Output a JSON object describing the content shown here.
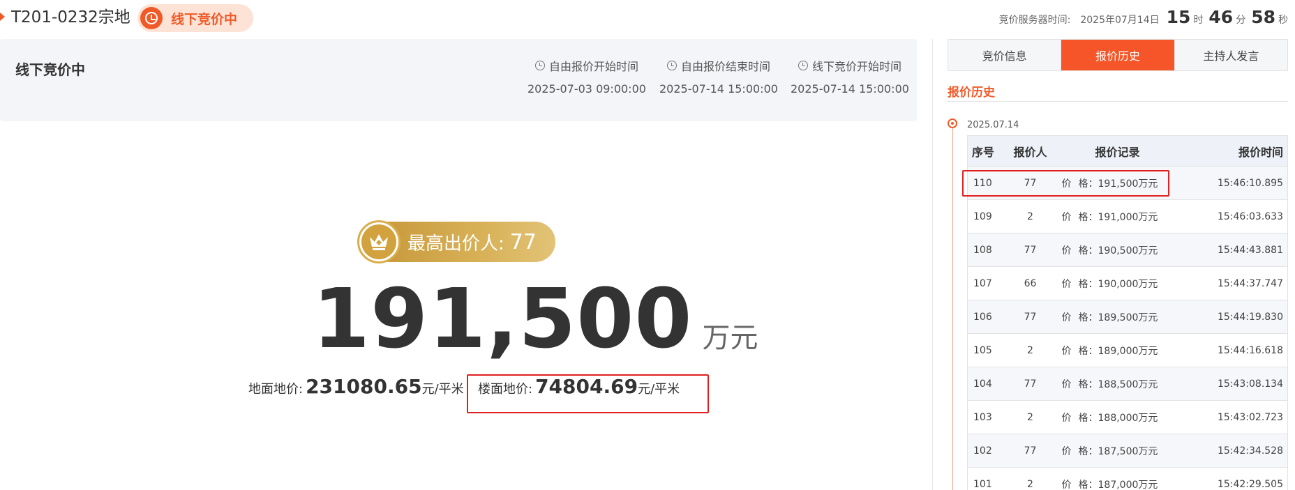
{
  "header": {
    "lot_code": "T201-0232宗地",
    "status": "线下竞价中",
    "server_time_label": "竞价服务器时间:",
    "server_date": "2025年07月14日",
    "hour": "15",
    "hour_unit": "时",
    "minute": "46",
    "minute_unit": "分",
    "second": "58",
    "second_unit": "秒"
  },
  "info": {
    "title": "线下竞价中",
    "times": [
      {
        "label": "自由报价开始时间",
        "value": "2025-07-03 09:00:00"
      },
      {
        "label": "自由报价结束时间",
        "value": "2025-07-14 15:00:00"
      },
      {
        "label": "线下竞价开始时间",
        "value": "2025-07-14 15:00:00"
      }
    ]
  },
  "price": {
    "top_bidder_label": "最高出价人:",
    "top_bidder": "77",
    "amount": "191,500",
    "amount_unit": "万元",
    "land_label": "地面地价:",
    "land_value": "231080.65",
    "land_unit": "元/平米",
    "floor_label": "楼面地价:",
    "floor_value": "74804.69",
    "floor_unit": "元/平米"
  },
  "tabs": [
    {
      "label": "竞价信息",
      "active": false
    },
    {
      "label": "报价历史",
      "active": true
    },
    {
      "label": "主持人发言",
      "active": false
    }
  ],
  "history": {
    "title": "报价历史",
    "date": "2025.07.14",
    "columns": [
      "序号",
      "报价人",
      "报价记录",
      "报价时间"
    ],
    "rows": [
      {
        "seq": "110",
        "bidder": "77",
        "rec_a": "价",
        "rec_b": "格：191,500万元",
        "time": "15:46:10.895"
      },
      {
        "seq": "109",
        "bidder": "2",
        "rec_a": "价",
        "rec_b": "格：191,000万元",
        "time": "15:46:03.633"
      },
      {
        "seq": "108",
        "bidder": "77",
        "rec_a": "价",
        "rec_b": "格：190,500万元",
        "time": "15:44:43.881"
      },
      {
        "seq": "107",
        "bidder": "66",
        "rec_a": "价",
        "rec_b": "格：190,000万元",
        "time": "15:44:37.747"
      },
      {
        "seq": "106",
        "bidder": "77",
        "rec_a": "价",
        "rec_b": "格：189,500万元",
        "time": "15:44:19.830"
      },
      {
        "seq": "105",
        "bidder": "2",
        "rec_a": "价",
        "rec_b": "格：189,000万元",
        "time": "15:44:16.618"
      },
      {
        "seq": "104",
        "bidder": "77",
        "rec_a": "价",
        "rec_b": "格：188,500万元",
        "time": "15:43:08.134"
      },
      {
        "seq": "103",
        "bidder": "2",
        "rec_a": "价",
        "rec_b": "格：188,000万元",
        "time": "15:43:02.723"
      },
      {
        "seq": "102",
        "bidder": "77",
        "rec_a": "价",
        "rec_b": "格：187,500万元",
        "time": "15:42:34.528"
      },
      {
        "seq": "101",
        "bidder": "2",
        "rec_a": "价",
        "rec_b": "格：187,000万元",
        "time": "15:42:29.505"
      }
    ]
  },
  "colors": {
    "accent": "#f05a28",
    "highlight_box": "#e02020",
    "gold": "#d1a23e"
  }
}
